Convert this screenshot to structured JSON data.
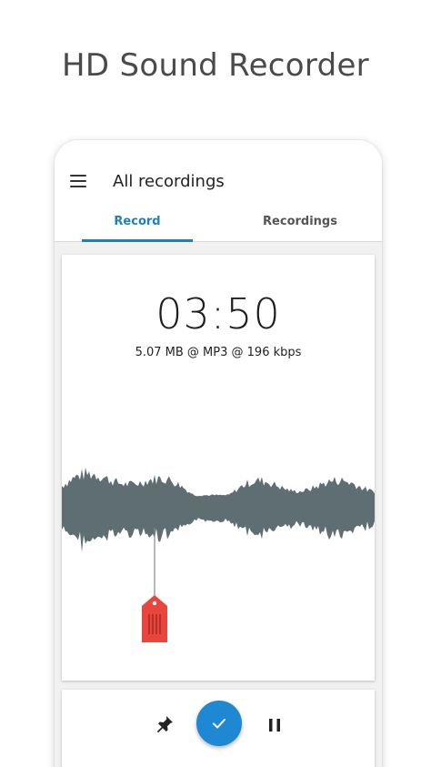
{
  "promo": {
    "title": "HD Sound Recorder"
  },
  "appbar": {
    "title": "All recordings",
    "menu_icon": "menu-icon"
  },
  "tabs": [
    {
      "label": "Record",
      "active": true
    },
    {
      "label": "Recordings",
      "active": false
    }
  ],
  "recorder": {
    "elapsed": "03:50",
    "file_info": "5.07 MB @ MP3 @ 196 kbps",
    "marker_icon": "bookmark-tag-icon"
  },
  "controls": {
    "pin_icon": "pin-icon",
    "done_icon": "check-icon",
    "pause_icon": "pause-icon"
  },
  "colors": {
    "accent": "#1a82c4",
    "action_button": "#1e88d2",
    "waveform": "#5f6e73",
    "marker": "#e8453c"
  }
}
